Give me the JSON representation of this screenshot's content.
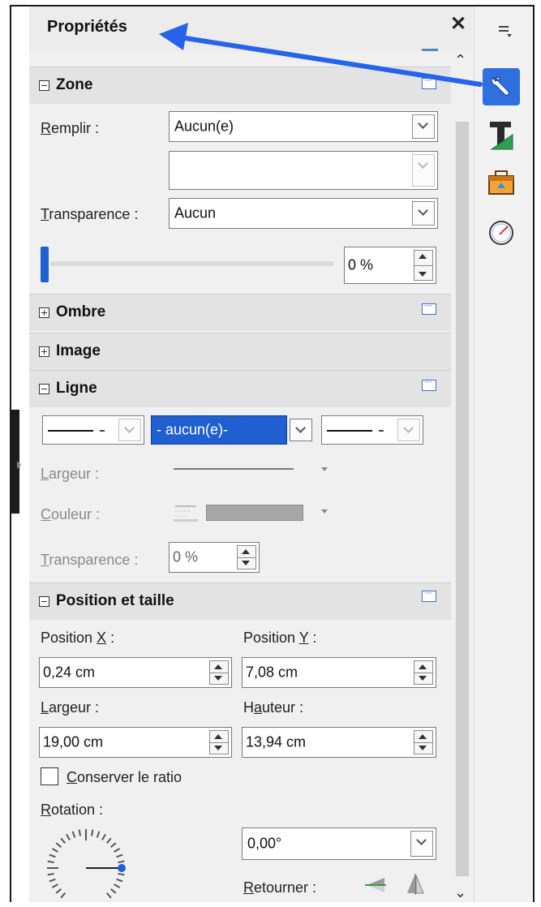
{
  "panel": {
    "title": "Propriétés"
  },
  "sections": {
    "zone": {
      "title": "Zone",
      "fill_label_u": "R",
      "fill_label_rest": "emplir :",
      "fill_value": "Aucun(e)",
      "fill_value2": "",
      "transparency_label_u": "T",
      "transparency_label_rest": "ransparence :",
      "transparency_value": "Aucun",
      "transparency_percent": "0 %",
      "transparency_slider_level": 0
    },
    "ombre": {
      "title": "Ombre"
    },
    "image": {
      "title": "Image"
    },
    "ligne": {
      "title": "Ligne",
      "arrow_style_value": "- aucun(e)-",
      "width_label_u": "L",
      "width_label_rest": "argeur :",
      "color_label_u": "C",
      "color_label_rest": "ouleur :",
      "transparency_label_u": "T",
      "transparency_label_rest": "ransparence :",
      "transparency_value": "0 %"
    },
    "position": {
      "title": "Position et taille",
      "pos_x_label_pre": "Position ",
      "pos_x_label_u": "X",
      "pos_x_label_post": " :",
      "pos_x_value": "0,24 cm",
      "pos_y_label_pre": "Position ",
      "pos_y_label_u": "Y",
      "pos_y_label_post": " :",
      "pos_y_value": "7,08 cm",
      "width_label_u": "L",
      "width_label_rest": "argeur :",
      "width_value": "19,00 cm",
      "height_label_pre": "H",
      "height_label_u": "a",
      "height_label_rest": "uteur :",
      "height_value": "13,94 cm",
      "keep_ratio_u": "C",
      "keep_ratio_rest": "onserver le ratio",
      "keep_ratio_checked": false,
      "rotation_label_u": "R",
      "rotation_label_rest": "otation :",
      "rotation_value": "0,00°",
      "flip_label_u": "R",
      "flip_label_rest": "etourner :"
    }
  },
  "tabbar": {
    "menu_icon": "hamburger-menu-icon",
    "tabs": [
      {
        "icon": "wrench-icon",
        "active": true
      },
      {
        "icon": "character-t-icon",
        "active": false
      },
      {
        "icon": "gallery-icon",
        "active": false
      },
      {
        "icon": "navigator-compass-icon",
        "active": false
      }
    ]
  },
  "colors": {
    "accent": "#2f6fde",
    "annotation_arrow": "#2563eb",
    "section_header": "#e3e3e3",
    "panel_background": "#f0f0f0"
  }
}
